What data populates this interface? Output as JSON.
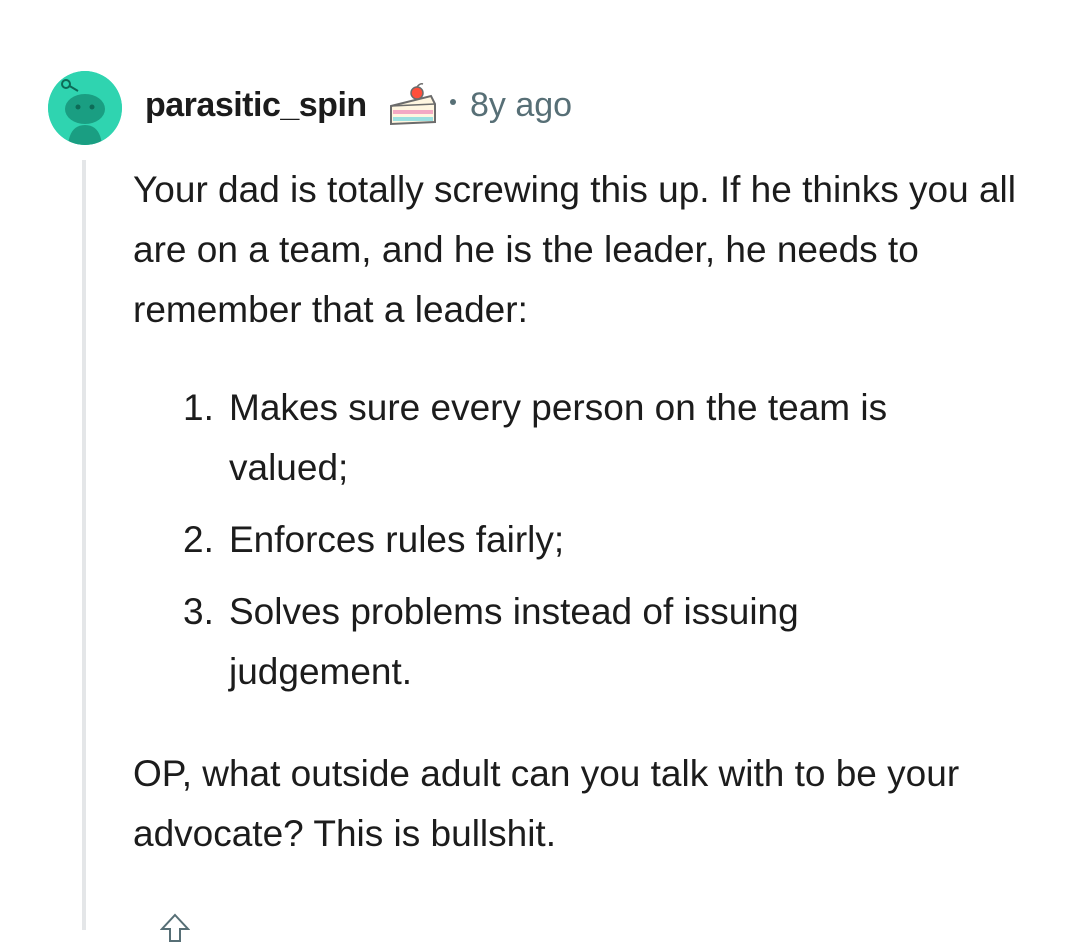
{
  "comment": {
    "username": "parasitic_spin",
    "separator": "•",
    "timestamp": "8y ago",
    "avatar_icon": "snoo-avatar-icon",
    "badge_icon": "cake-day-icon",
    "paragraph_1": "Your dad is totally screwing this up. If he thinks you all are on a team, and he is the leader, he needs to remember that a leader:",
    "list": [
      {
        "number": "1.",
        "text": "Makes sure every person on the team is valued;"
      },
      {
        "number": "2.",
        "text": "Enforces rules fairly;"
      },
      {
        "number": "3.",
        "text": "Solves problems instead of issuing judgement."
      }
    ],
    "paragraph_2": "OP, what outside adult can you talk with to be your advocate? This is bullshit."
  },
  "colors": {
    "avatar_bg": "#2fd4b0",
    "text": "#1c1c1c",
    "meta": "#576f76",
    "thread_line": "#e4e6e8"
  }
}
